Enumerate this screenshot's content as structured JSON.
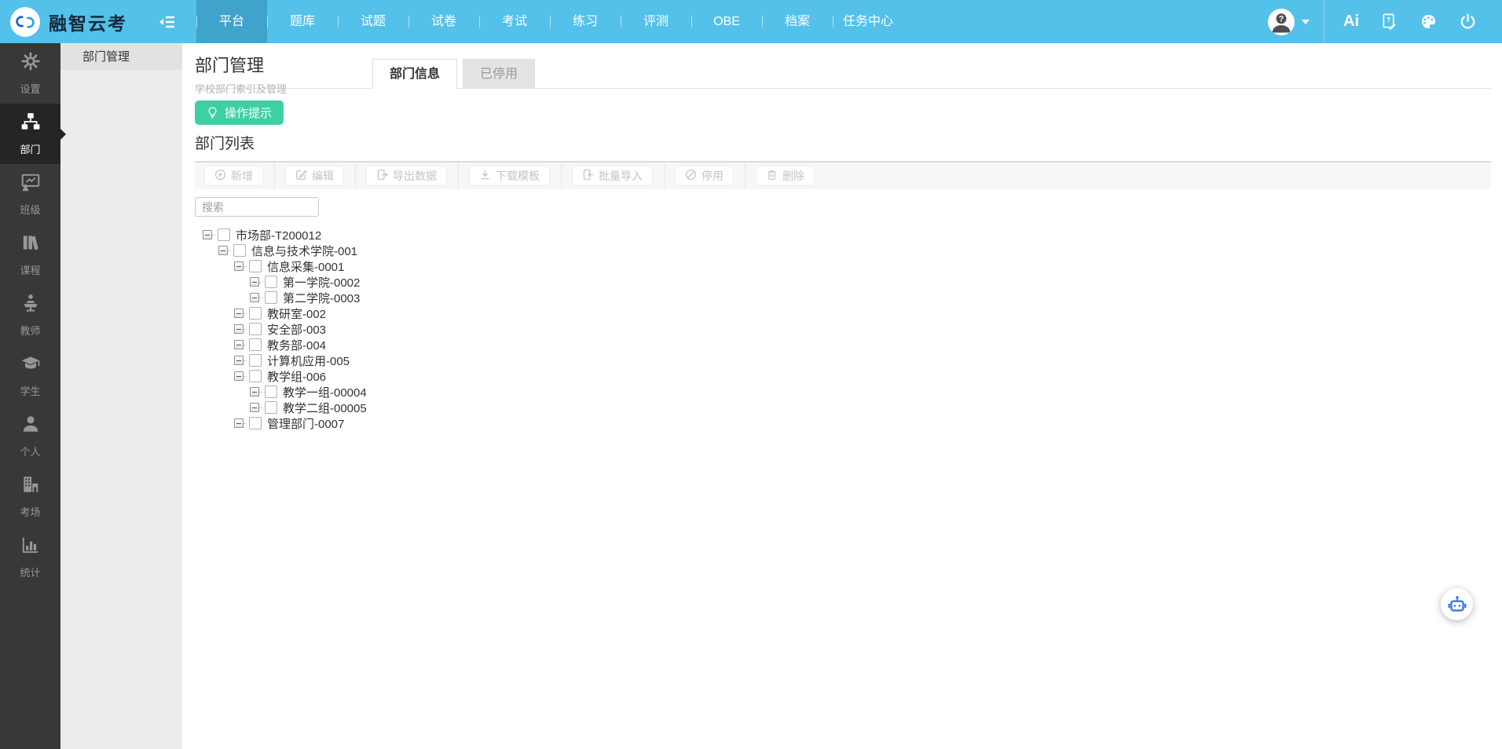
{
  "topbar": {
    "brand": "融智云考",
    "nav": [
      {
        "label": "平台",
        "active": true
      },
      {
        "label": "题库"
      },
      {
        "label": "试题"
      },
      {
        "label": "试卷"
      },
      {
        "label": "考试"
      },
      {
        "label": "练习"
      },
      {
        "label": "评测"
      },
      {
        "label": "OBE"
      },
      {
        "label": "档案"
      },
      {
        "label": "任务中心"
      }
    ],
    "right": {
      "ai_label": "Ai"
    }
  },
  "sidebar": {
    "items": [
      {
        "label": "设置",
        "icon": "gear-icon"
      },
      {
        "label": "部门",
        "icon": "sitemap-icon",
        "active": true
      },
      {
        "label": "班级",
        "icon": "class-icon"
      },
      {
        "label": "课程",
        "icon": "course-icon"
      },
      {
        "label": "教师",
        "icon": "teacher-icon"
      },
      {
        "label": "学生",
        "icon": "student-icon"
      },
      {
        "label": "个人",
        "icon": "person-icon"
      },
      {
        "label": "考场",
        "icon": "venue-icon"
      },
      {
        "label": "统计",
        "icon": "stats-icon"
      }
    ]
  },
  "subsidebar": {
    "items": [
      {
        "label": "部门管理",
        "active": true
      }
    ]
  },
  "page": {
    "title": "部门管理",
    "subtitle": "学校部门索引及管理",
    "tabs": [
      {
        "label": "部门信息",
        "active": true
      },
      {
        "label": "已停用"
      }
    ],
    "tip_button": "操作提示",
    "list_title": "部门列表",
    "toolbar": [
      {
        "label": "新增",
        "icon": "plus-circle-icon"
      },
      {
        "label": "编辑",
        "icon": "edit-icon"
      },
      {
        "label": "导出数据",
        "icon": "export-icon"
      },
      {
        "label": "下载模板",
        "icon": "download-icon"
      },
      {
        "label": "批量导入",
        "icon": "import-icon"
      },
      {
        "label": "停用",
        "icon": "ban-icon"
      },
      {
        "label": "删除",
        "icon": "trash-icon"
      }
    ],
    "search_placeholder": "搜索",
    "tree": [
      {
        "label": "市场部-T200012",
        "level": 0
      },
      {
        "label": "信息与技术学院-001",
        "level": 1
      },
      {
        "label": "信息采集-0001",
        "level": 2
      },
      {
        "label": "第一学院-0002",
        "level": 3
      },
      {
        "label": "第二学院-0003",
        "level": 3
      },
      {
        "label": "教研室-002",
        "level": 2
      },
      {
        "label": "安全部-003",
        "level": 2
      },
      {
        "label": "教务部-004",
        "level": 2
      },
      {
        "label": "计算机应用-005",
        "level": 2
      },
      {
        "label": "教学组-006",
        "level": 2
      },
      {
        "label": "教学一组-00004",
        "level": 3
      },
      {
        "label": "教学二组-00005",
        "level": 3
      },
      {
        "label": "管理部门-0007",
        "level": 2
      }
    ]
  },
  "colors": {
    "topbar_blue": "#53c1e9",
    "topbar_active_blue": "#3fa3cc",
    "sidebar_dark": "#383838",
    "accent_green": "#3ed0a2",
    "robot_blue": "#4176dd"
  }
}
